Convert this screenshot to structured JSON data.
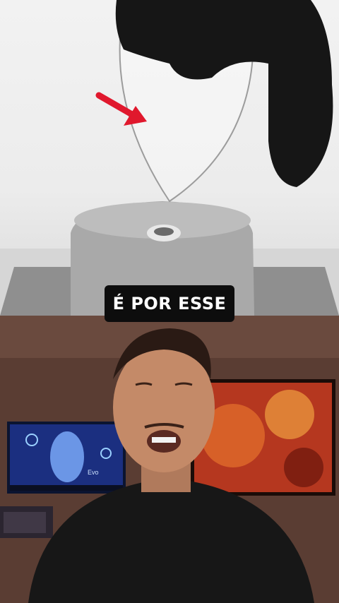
{
  "caption": {
    "text": "É POR ESSE"
  },
  "top_scene": {
    "description_colors": {
      "background": "#efefef",
      "glove": "#161616",
      "pedestal": "#a8a8a8",
      "arrow": "#e0182d"
    },
    "icons": [
      "red-arrow-icon"
    ]
  },
  "bottom_scene": {
    "monitor_left": {
      "label": "Evo"
    },
    "colors": {
      "wall": "#5a3d33",
      "shirt": "#171717",
      "art": "#c0402a"
    }
  }
}
